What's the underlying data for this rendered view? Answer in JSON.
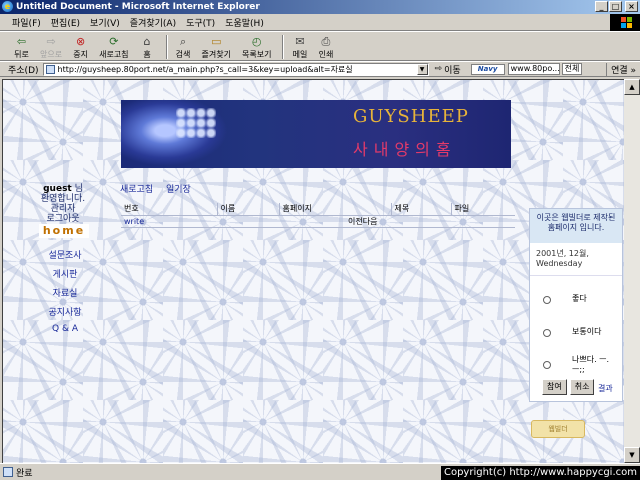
{
  "window": {
    "title": "Untitled Document - Microsoft Internet Explorer",
    "min": "_",
    "max": "□",
    "close": "×"
  },
  "menu": [
    "파일(F)",
    "편집(E)",
    "보기(V)",
    "즐겨찾기(A)",
    "도구(T)",
    "도움말(H)"
  ],
  "toolbar": {
    "back": "뒤로",
    "forward": "앞으로",
    "stop": "중지",
    "refresh": "새로고침",
    "home": "홈",
    "search": "검색",
    "favorites": "즐겨찾기",
    "history": "목록보기",
    "mail": "메일",
    "print": "인쇄"
  },
  "address": {
    "label": "주소(D)",
    "url": "http://guysheep.80port.net/a_main.php?s_call=3&key=upload&alt=자료실",
    "go": "이동",
    "navy_logo": "Navy",
    "navy_value": "www.80po...",
    "navy_all": "전체",
    "links": "연결 »"
  },
  "banner": {
    "title": "GUYSHEEP",
    "subtitle": "사내양의홈"
  },
  "user": {
    "name": "guest",
    "suffix": "님",
    "welcome": "환영합니다.",
    "admin": "관리자",
    "logout": "로그아웃"
  },
  "nav": {
    "home": "home",
    "items": [
      "설문조사",
      "게시판",
      "자료실",
      "공지사항",
      "Q & A"
    ]
  },
  "board": {
    "top_links": [
      "새로고침",
      "일기장"
    ],
    "headers": [
      "번호",
      "이름",
      "홈페이지",
      "제목",
      "파일"
    ],
    "write": "write",
    "pager": "이전다음"
  },
  "poll": {
    "question": "이곳은 웹빌더로 제작된 홈페이지 입니다.",
    "date": "2001년, 12월,",
    "weekday": "Wednesday",
    "options": [
      "좋다",
      "보통이다",
      "나쁘다. ㅡ.ㅡ;;"
    ],
    "vote": "참여",
    "cancel": "취소",
    "result": "결과"
  },
  "counter": "웹빌더",
  "status": {
    "text": "완료",
    "copyright": "Copyright(c) http://www.happycgi.com"
  },
  "colors": {
    "titlebar": "#0a246a",
    "banner": "#1b2a78",
    "title_gold": "#e7b43a",
    "subtitle_pink": "#e23a6a",
    "link": "#1a2a9a"
  }
}
